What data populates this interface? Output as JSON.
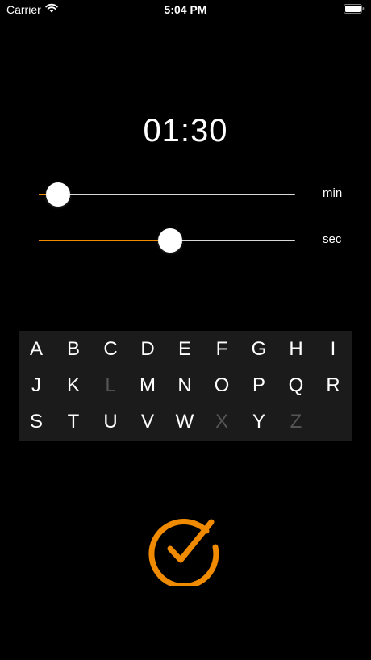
{
  "status_bar": {
    "carrier": "Carrier",
    "time": "5:04 PM"
  },
  "timer": {
    "display": "01:30"
  },
  "sliders": [
    {
      "unit": "min",
      "fraction": 0.074
    },
    {
      "unit": "sec",
      "fraction": 0.513
    }
  ],
  "alphabet": {
    "rows": [
      [
        "A",
        "B",
        "C",
        "D",
        "E",
        "F",
        "G",
        "H",
        "I"
      ],
      [
        "J",
        "K",
        "L",
        "M",
        "N",
        "O",
        "P",
        "Q",
        "R"
      ],
      [
        "S",
        "T",
        "U",
        "V",
        "W",
        "X",
        "Y",
        "Z"
      ]
    ],
    "disabled": [
      "L",
      "X",
      "Z"
    ]
  },
  "confirm": {
    "icon": "checkmark-circle-icon"
  },
  "colors": {
    "accent": "#f08a00",
    "background": "#000000",
    "track": "#d8d8d8",
    "keyboard_bg": "#1b1b1b",
    "disabled_letter": "#555555"
  }
}
